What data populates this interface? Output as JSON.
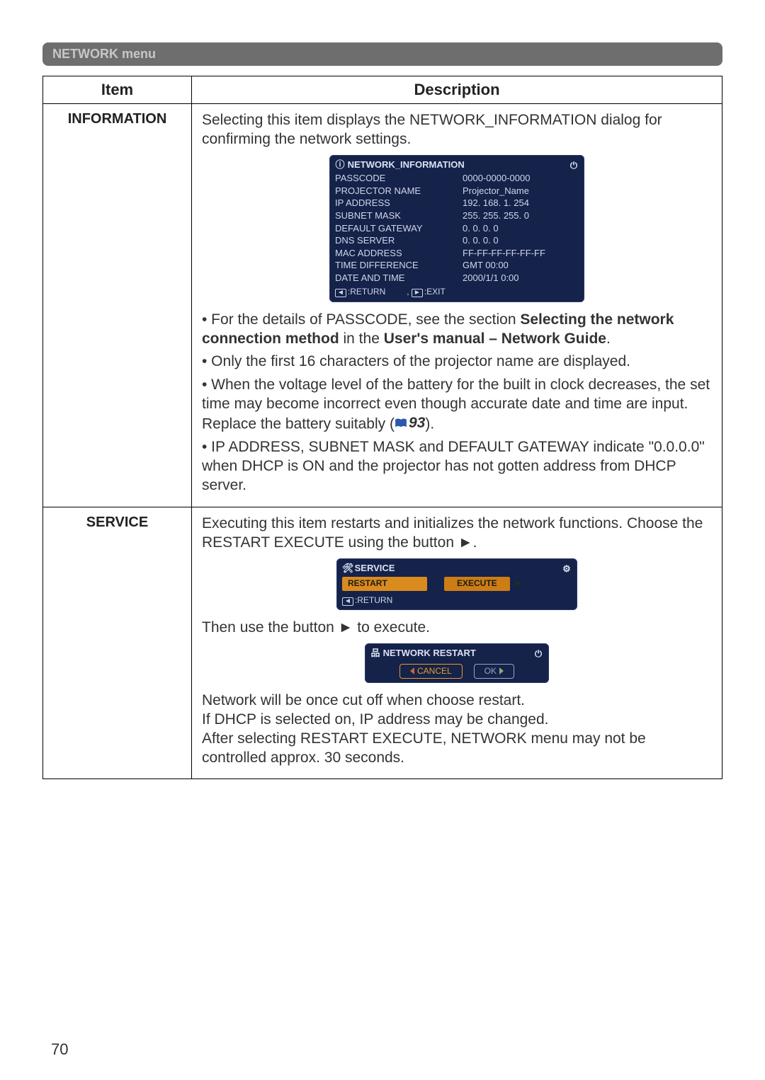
{
  "menu_bar": "NETWORK menu",
  "headers": {
    "item": "Item",
    "description": "Description"
  },
  "page_number": "70",
  "information": {
    "item_label": "INFORMATION",
    "intro": "Selecting this item displays the NETWORK_INFORMATION dialog for confirming the network settings.",
    "osd": {
      "title": "NETWORK_INFORMATION",
      "labels": [
        "PASSCODE",
        "PROJECTOR NAME",
        "IP ADDRESS",
        "SUBNET MASK",
        "DEFAULT GATEWAY",
        "DNS SERVER",
        "MAC ADDRESS",
        "TIME DIFFERENCE",
        "DATE AND TIME"
      ],
      "values": [
        "0000-0000-0000",
        "Projector_Name",
        "192. 168.  1. 254",
        "255. 255. 255.  0",
        "0. 0. 0. 0",
        "0. 0. 0. 0",
        "FF-FF-FF-FF-FF-FF",
        "GMT 00:00",
        "2000/1/1  0:00"
      ],
      "foot_return": ":RETURN",
      "foot_exit": ":EXIT"
    },
    "bullets": {
      "b1_pre": "• For the details of PASSCODE, see the section ",
      "b1_bold1": "Selecting the network connection method",
      "b1_mid": " in the ",
      "b1_bold2": "User's manual – Network Guide",
      "b1_end": ".",
      "b2": "• Only the first 16 characters of the projector name are displayed.",
      "b3_pre": "• When the voltage level of the battery for the built in clock decreases, the set time may become incorrect even though accurate date and time are input. Replace the battery suitably (",
      "b3_ref": "93",
      "b3_post": ").",
      "b4": "• IP ADDRESS, SUBNET MASK and DEFAULT GATEWAY indicate \"0.0.0.0\" when DHCP is ON and the projector has not gotten address from DHCP server."
    }
  },
  "service": {
    "item_label": "SERVICE",
    "p1": "Executing this item restarts and initializes the network functions. Choose the RESTART EXECUTE using the button ►.",
    "osd_service": {
      "title": "SERVICE",
      "restart": "RESTART",
      "execute": "EXECUTE",
      "return": ":RETURN"
    },
    "p2": "Then use the button ► to execute.",
    "osd_restart": {
      "title": "NETWORK RESTART",
      "cancel": "CANCEL",
      "ok": "OK"
    },
    "p3": "Network will be once cut off when choose restart.\nIf DHCP is selected on, IP address may be changed.\nAfter selecting RESTART EXECUTE, NETWORK menu may not be controlled approx. 30 seconds."
  }
}
